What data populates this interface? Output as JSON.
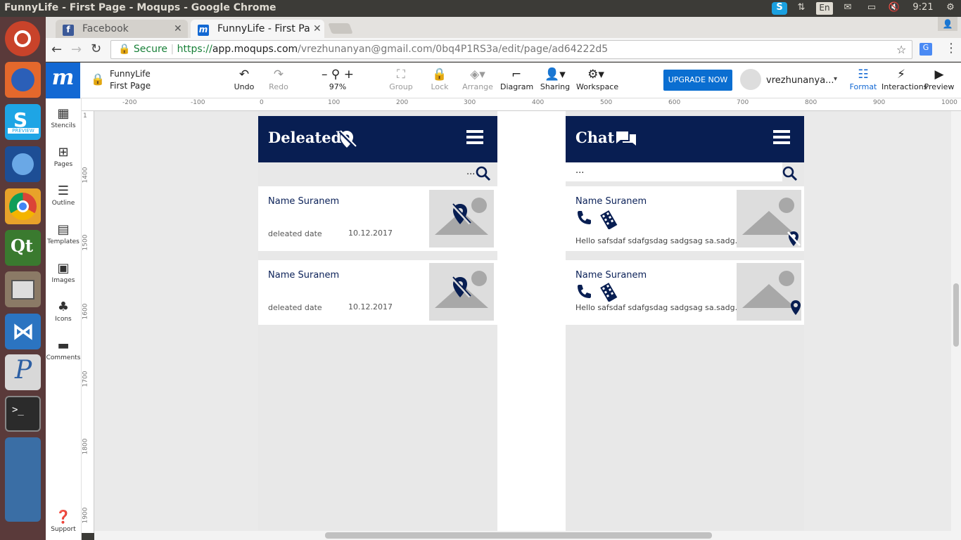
{
  "os": {
    "window_title": "FunnyLife - First Page - Moqups - Google Chrome",
    "keyboard_layout": "En",
    "clock": "9:21"
  },
  "launcher": {
    "items": [
      "ubuntu-logo",
      "firefox",
      "skype-preview",
      "thunderbird",
      "chrome",
      "qt-creator",
      "files",
      "vscode",
      "pencil",
      "terminal",
      "office-stack",
      "trash"
    ],
    "preview_badge": "PREVIEW"
  },
  "browser": {
    "tabs": [
      {
        "label": "Facebook",
        "active": false
      },
      {
        "label": "FunnyLife - First Pa",
        "active": true
      }
    ],
    "secure_label": "Secure",
    "url_scheme": "https://",
    "url_host": "app.moqups.com",
    "url_path": "/vrezhunanyan@gmail.com/0bq4P1RS3a/edit/page/ad64222d5"
  },
  "app": {
    "logo": "m",
    "project": "FunnyLife",
    "page": "First Page",
    "undo": "Undo",
    "redo": "Redo",
    "zoom": "97%",
    "group": "Group",
    "lock": "Lock",
    "arrange": "Arrange",
    "diagram": "Diagram",
    "sharing": "Sharing",
    "workspace": "Workspace",
    "upgrade": "UPGRADE NOW",
    "user": "vrezhunanya...",
    "format": "Format",
    "interactions": "Interactions",
    "preview": "Preview",
    "zoom_minus": "–",
    "zoom_plus": "+"
  },
  "left_tools": [
    "Stencils",
    "Pages",
    "Outline",
    "Templates",
    "Images",
    "Icons",
    "Comments",
    "Support"
  ],
  "ruler_h": [
    "-200",
    "-100",
    "0",
    "100",
    "200",
    "300",
    "400",
    "500",
    "600",
    "700",
    "800",
    "900",
    "1000"
  ],
  "ruler_v": [
    "1",
    "1400",
    "1500",
    "1600",
    "1700",
    "1800",
    "1900"
  ],
  "deleted_page": {
    "title": "Deleated",
    "search_placeholder": "...",
    "items": [
      {
        "name": "Name Suranem",
        "date_label": "deleated date",
        "date": "10.12.2017"
      },
      {
        "name": "Name Suranem",
        "date_label": "deleated date",
        "date": "10.12.2017"
      }
    ]
  },
  "chat_page": {
    "title": "Chat",
    "search_value": "...",
    "items": [
      {
        "name": "Name Suranem",
        "message": "Hello safsdaf sdafgsdag sadgsag sa.sadg..."
      },
      {
        "name": "Name Suranem",
        "message": "Hello safsdaf sdafgsdag sadgsag sa.sadg..."
      }
    ]
  },
  "colors": {
    "nav": "#081e52",
    "accent": "#0f6fd6",
    "upgrade": "#0a6ed1",
    "chrome_tab": "#e4e2df"
  }
}
